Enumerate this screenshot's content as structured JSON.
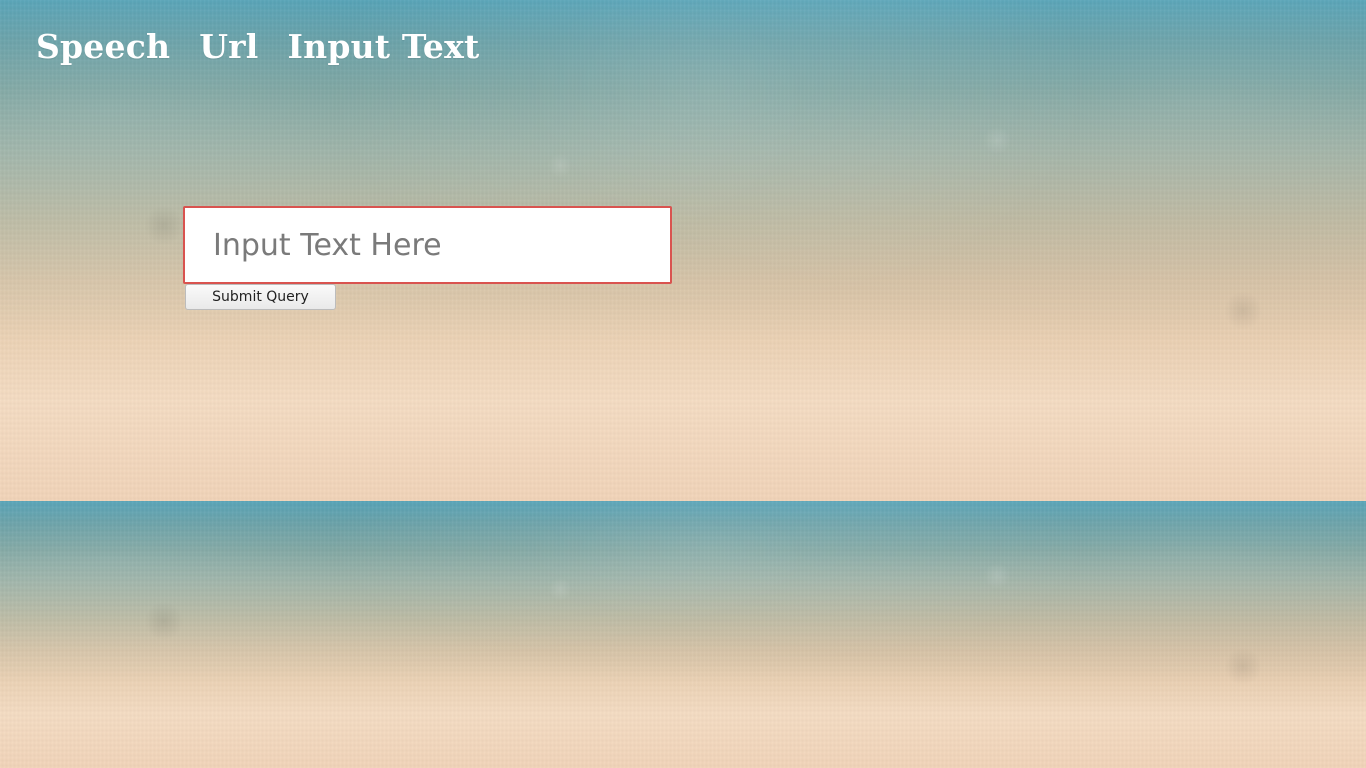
{
  "nav": {
    "items": [
      {
        "label": "Speech"
      },
      {
        "label": "Url"
      },
      {
        "label": "Input Text"
      }
    ]
  },
  "form": {
    "input": {
      "value": "",
      "placeholder": "Input Text Here"
    },
    "submit_label": "Submit Query"
  },
  "colors": {
    "nav_text": "#ffffff",
    "input_border": "#d9534f",
    "input_background": "#ffffff",
    "button_text": "#222222"
  }
}
